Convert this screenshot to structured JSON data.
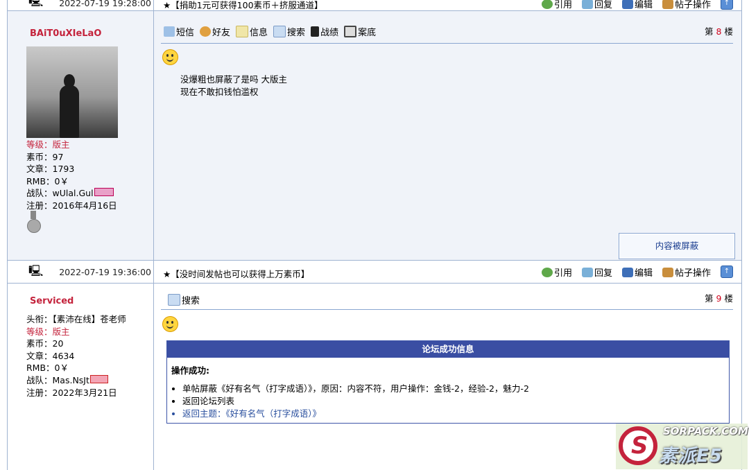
{
  "bar1": {
    "date": "2022-07-19 19:28:00",
    "ad": "★【捐助1元可获得100素币＋挤服通道】"
  },
  "bar2": {
    "date": "2022-07-19 19:36:00",
    "ad": "★【没时间发帖也可以获得上万素币】"
  },
  "ops": {
    "quote": "引用",
    "reply": "回复",
    "edit": "编辑",
    "manage": "帖子操作",
    "top": "↑"
  },
  "post1": {
    "username": "BAiT0uXIeLaO",
    "level_label": "等级：",
    "level": "版主",
    "coins_label": "素币：",
    "coins": "97",
    "posts_label": "文章：",
    "posts": "1793",
    "rmb_label": "RMB：",
    "rmb": "0￥",
    "team_label": "战队：",
    "team": "wUlal.Gul",
    "reg_label": "注册：",
    "reg": "2016年4月16日",
    "tools": {
      "sms": "短信",
      "friend": "好友",
      "info": "信息",
      "search": "搜索",
      "record": "战绩",
      "profile": "案底"
    },
    "floor_prefix": "第",
    "floor": "8",
    "floor_suffix": "楼",
    "message": [
      "没爆粗也屏蔽了是吗 大版主",
      "现在不敢扣钱怕滥权"
    ],
    "blocked": "内容被屏蔽"
  },
  "post2": {
    "username": "Serviced",
    "title_label": "头衔：",
    "title": "【素沛在线】苍老师",
    "level_label": "等级：",
    "level": "版主",
    "coins_label": "素币：",
    "coins": "20",
    "posts_label": "文章：",
    "posts": "4634",
    "rmb_label": "RMB：",
    "rmb": "0￥",
    "team_label": "战队：",
    "team": "Mas.NsJt",
    "reg_label": "注册：",
    "reg": "2022年3月21日",
    "tools": {
      "search": "搜索"
    },
    "floor_prefix": "第",
    "floor": "9",
    "floor_suffix": "楼",
    "notice": {
      "header": "论坛成功信息",
      "status": "操作成功:",
      "items": [
        "单帖屏蔽《好有名气（打字成语）》，原因：内容不符，用户操作：金钱-2，经验-2，魅力-2",
        "返回论坛列表",
        "返回主题：《好有名气（打字成语）》"
      ]
    }
  },
  "watermark": {
    "line1": "SORPACK.COM",
    "line2": "素派E5"
  },
  "colors": {
    "border": "#9fb3d1",
    "accent_red": "#c4233c",
    "notice_header": "#3a4ea3",
    "link": "#2a4f9e"
  }
}
